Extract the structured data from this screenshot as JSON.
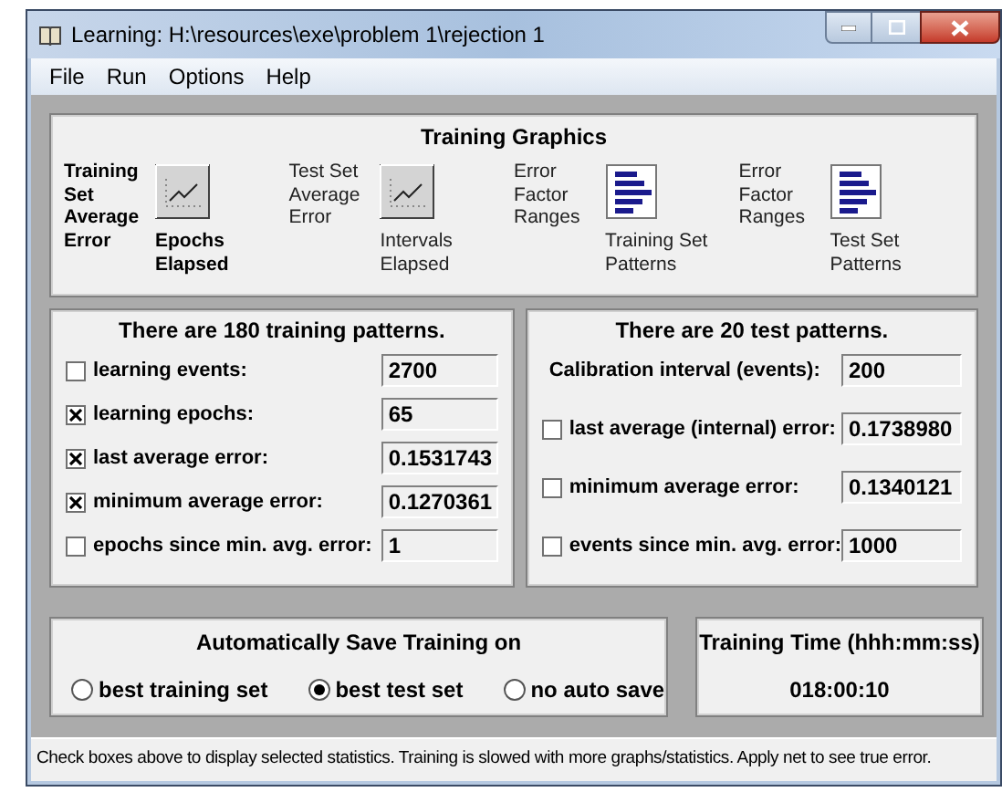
{
  "window": {
    "title": "Learning: H:\\resources\\exe\\problem 1\\rejection 1"
  },
  "menu": [
    "File",
    "Run",
    "Options",
    "Help"
  ],
  "graphics": {
    "title": "Training Graphics",
    "items": [
      {
        "kind": "line",
        "caption": "Training Set Average Error",
        "axis": "Epochs Elapsed",
        "selected": true
      },
      {
        "kind": "line",
        "caption": "Test Set Average Error",
        "axis": "Intervals Elapsed",
        "selected": false
      },
      {
        "kind": "bars",
        "caption": "Error Factor Ranges",
        "axis": "Training Set Patterns",
        "selected": false
      },
      {
        "kind": "bars",
        "caption": "Error Factor Ranges",
        "axis": "Test Set Patterns",
        "selected": false
      }
    ]
  },
  "training": {
    "title": "There are 180 training patterns.",
    "rows": [
      {
        "kind": "check",
        "label": "learning events:",
        "value": "2700",
        "checked": false
      },
      {
        "kind": "check",
        "label": "learning epochs:",
        "value": "65",
        "checked": true
      },
      {
        "kind": "check",
        "label": "last average error:",
        "value": "0.1531743",
        "checked": true
      },
      {
        "kind": "check",
        "label": "minimum average error:",
        "value": "0.1270361",
        "checked": true
      },
      {
        "kind": "check",
        "label": "epochs since min. avg. error:",
        "value": "1",
        "checked": false
      }
    ]
  },
  "test": {
    "title": "There are 20 test patterns.",
    "rows": [
      {
        "kind": "plain",
        "label": "Calibration interval (events):",
        "value": "200"
      },
      {
        "kind": "check",
        "label": "last average (internal) error:",
        "value": "0.1738980",
        "checked": false
      },
      {
        "kind": "check",
        "label": "minimum average error:",
        "value": "0.1340121",
        "checked": false
      },
      {
        "kind": "check",
        "label": "events since min. avg. error:",
        "value": "1000",
        "checked": false
      }
    ]
  },
  "autosave": {
    "title": "Automatically Save Training on",
    "options": [
      {
        "label": "best training set",
        "selected": false
      },
      {
        "label": "best test set",
        "selected": true
      },
      {
        "label": "no auto save",
        "selected": false
      }
    ]
  },
  "time": {
    "title": "Training Time (hhh:mm:ss)",
    "value": "018:00:10"
  },
  "status_bar": "Check boxes above to display selected statistics. Training is slowed with more graphs/statistics. Apply net to see true error."
}
